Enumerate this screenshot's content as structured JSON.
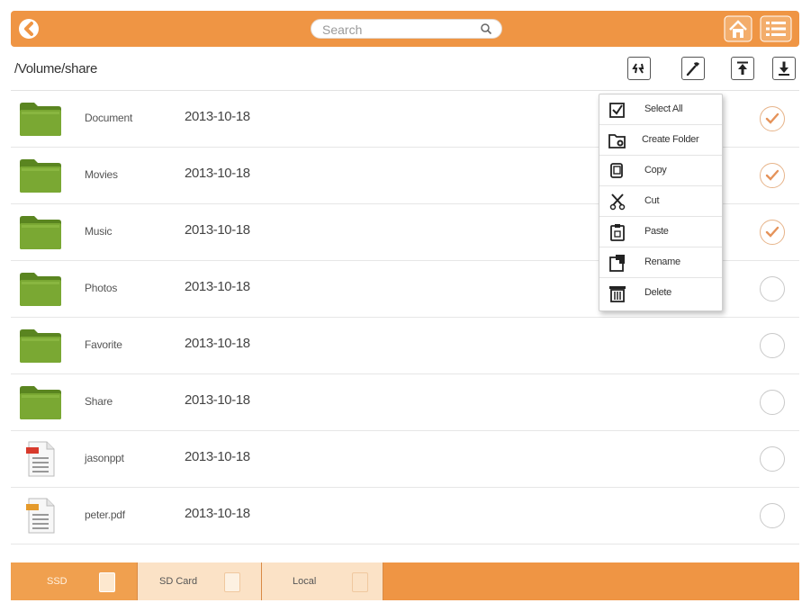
{
  "search": {
    "placeholder": "Search"
  },
  "path": "/Volume/share",
  "toolbar": {
    "refresh_icon": "refresh-icon",
    "tools_icon": "wrench-icon",
    "upload_icon": "upload-icon",
    "download_icon": "download-icon"
  },
  "files": [
    {
      "name": "Document",
      "date": "2013-10-18",
      "type": "folder",
      "checked": true
    },
    {
      "name": "Movies",
      "date": "2013-10-18",
      "type": "folder",
      "checked": true
    },
    {
      "name": "Music",
      "date": "2013-10-18",
      "type": "folder",
      "checked": true
    },
    {
      "name": "Photos",
      "date": "2013-10-18",
      "type": "folder",
      "checked": false
    },
    {
      "name": "Favorite",
      "date": "2013-10-18",
      "type": "folder",
      "checked": false
    },
    {
      "name": "Share",
      "date": "2013-10-18",
      "type": "folder",
      "checked": false
    },
    {
      "name": "jasonppt",
      "date": "2013-10-18",
      "type": "ppt",
      "checked": false
    },
    {
      "name": "peter.pdf",
      "date": "2013-10-18",
      "type": "pdf",
      "checked": false
    }
  ],
  "context_menu": [
    {
      "label": "Select All",
      "icon": "select-all-icon"
    },
    {
      "label": "Create Folder",
      "icon": "create-folder-icon"
    },
    {
      "label": "Copy",
      "icon": "copy-icon"
    },
    {
      "label": "Cut",
      "icon": "scissors-icon"
    },
    {
      "label": "Paste",
      "icon": "paste-icon"
    },
    {
      "label": "Rename",
      "icon": "rename-icon"
    },
    {
      "label": "Delete",
      "icon": "trash-icon"
    }
  ],
  "tabs": [
    {
      "label": "SSD",
      "active": true
    },
    {
      "label": "SD Card",
      "active": false
    },
    {
      "label": "Local",
      "active": false
    }
  ],
  "colors": {
    "accent": "#ef9544",
    "folder": "#6e9a2a",
    "tab_active": "#f0a04f",
    "tab_inactive": "#fbe2c6"
  }
}
